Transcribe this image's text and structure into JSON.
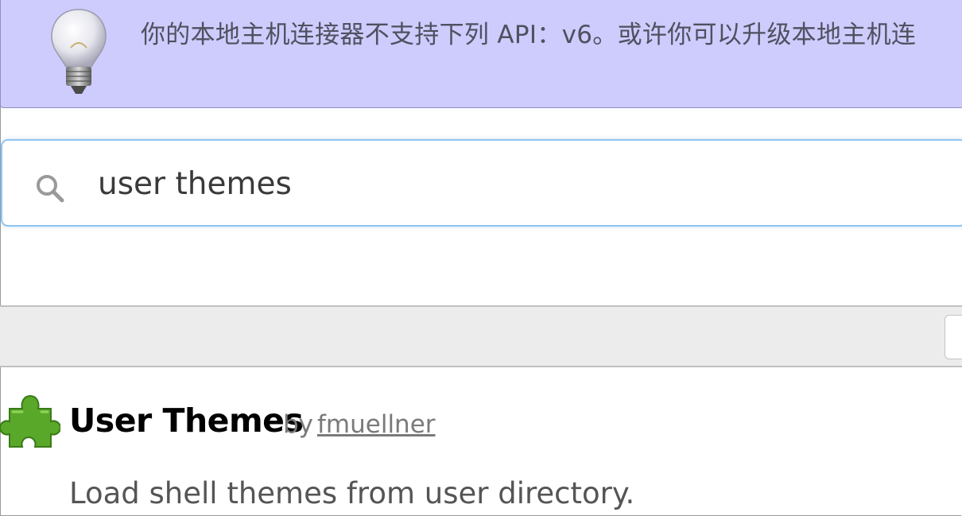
{
  "notice": {
    "icon": "lightbulb-icon",
    "text": "你的本地主机连接器不支持下列 API：v6。或许你可以升级本地主机连"
  },
  "search": {
    "icon": "search-icon",
    "value": "user themes"
  },
  "extension": {
    "icon": "puzzle-piece-icon",
    "name": "User Themes",
    "by": "by",
    "author": "fmuellner",
    "description": "Load shell themes from user directory."
  },
  "colors": {
    "notice_bg": "#cdccfd",
    "search_border": "#8fc4f0",
    "toolbar_bg": "#ececec",
    "extension_icon": "#5aa82a"
  }
}
